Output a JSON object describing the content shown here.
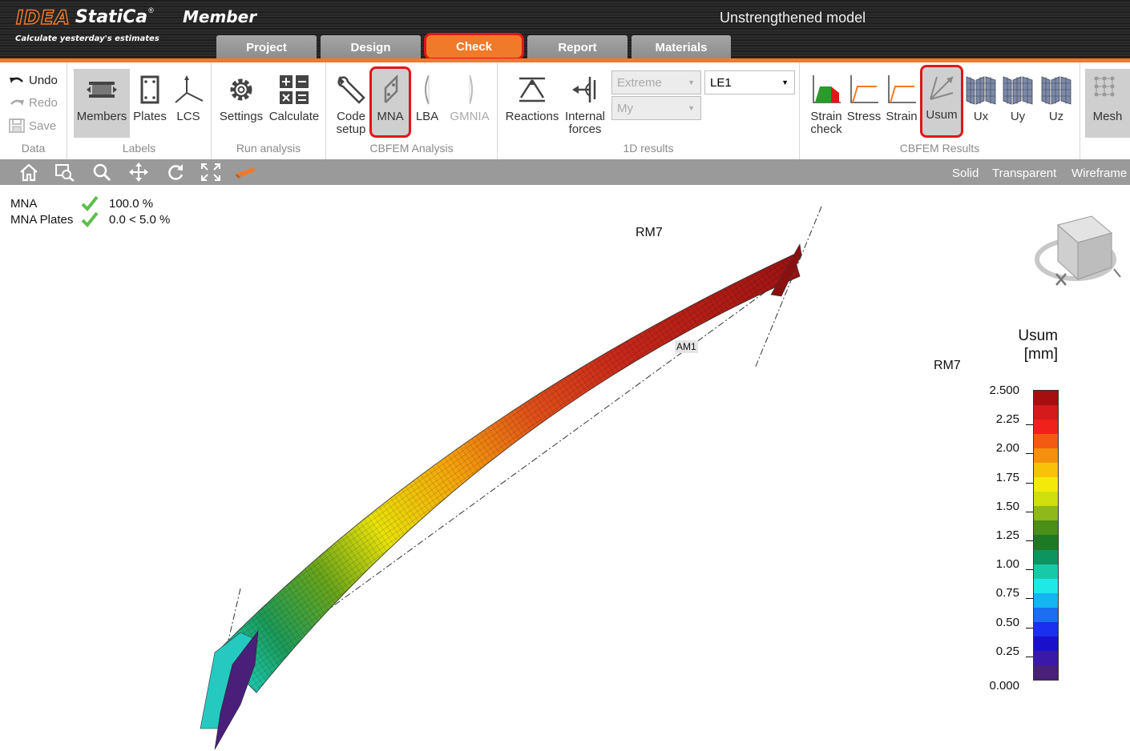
{
  "header": {
    "logo_idea": "IDEA",
    "logo_statica": "StatiCa",
    "logo_reg": "®",
    "product": "Member",
    "slogan": "Calculate yesterday's estimates",
    "model_title": "Unstrengthened model",
    "tabs": [
      {
        "label": "Project",
        "active": false
      },
      {
        "label": "Design",
        "active": false
      },
      {
        "label": "Check",
        "active": true
      },
      {
        "label": "Report",
        "active": false
      },
      {
        "label": "Materials",
        "active": false
      }
    ]
  },
  "ribbon": {
    "data_group": {
      "label": "Data",
      "undo": "Undo",
      "redo": "Redo",
      "save": "Save"
    },
    "labels_group": {
      "label": "Labels",
      "members": "Members",
      "plates": "Plates",
      "lcs": "LCS"
    },
    "run_group": {
      "label": "Run analysis",
      "settings": "Settings",
      "calculate": "Calculate"
    },
    "cbfem_group": {
      "label": "CBFEM Analysis",
      "code_setup_1": "Code",
      "code_setup_2": "setup",
      "mna": "MNA",
      "lba": "LBA",
      "gmnia": "GMNIA"
    },
    "results1d_group": {
      "label": "1D results",
      "reactions": "Reactions",
      "internal_forces_1": "Internal",
      "internal_forces_2": "forces",
      "extreme_select": "Extreme",
      "component_select": "My",
      "load_select": "LE1"
    },
    "cbfem_results_group": {
      "label": "CBFEM Results",
      "strain_check_1": "Strain",
      "strain_check_2": "check",
      "stress": "Stress",
      "strain": "Strain",
      "usum": "Usum",
      "ux": "Ux",
      "uy": "Uy",
      "uz": "Uz"
    },
    "mesh_group": {
      "mesh": "Mesh"
    }
  },
  "toolbar": {
    "icons": [
      "home-icon",
      "zoom-window-icon",
      "zoom-icon",
      "pan-icon",
      "rotate-icon",
      "fit-screen-icon",
      "member-icon"
    ],
    "view_modes": [
      "Solid",
      "Transparent",
      "Wireframe"
    ]
  },
  "results_summary": [
    {
      "name": "MNA",
      "value": "100.0 %",
      "status": "ok"
    },
    {
      "name": "MNA Plates",
      "value": "0.0 < 5.0 %",
      "status": "ok"
    }
  ],
  "model_labels": {
    "member_top": "RM7",
    "member_right": "RM7",
    "analysis_model": "AM1"
  },
  "legend": {
    "title_1": "Usum",
    "title_2": "[mm]",
    "ticks": [
      "2.500",
      "2.25",
      "2.00",
      "1.75",
      "1.50",
      "1.25",
      "1.00",
      "0.75",
      "0.50",
      "0.25",
      "0.000"
    ],
    "colors": [
      "#a50f0f",
      "#d41a1a",
      "#f0201a",
      "#f25a12",
      "#f5900e",
      "#f9c20a",
      "#f4ea0a",
      "#cfe00e",
      "#8fb81a",
      "#4a8f16",
      "#1c7a24",
      "#0e9460",
      "#18c9a8",
      "#1ee9e6",
      "#14b5f0",
      "#1a6ef0",
      "#1a2ff0",
      "#1a10cc",
      "#3a18a8",
      "#4a1f7a"
    ]
  },
  "colors": {
    "accent": "#f07a2a",
    "highlight": "#e01717",
    "ok": "#5cbf4a"
  }
}
